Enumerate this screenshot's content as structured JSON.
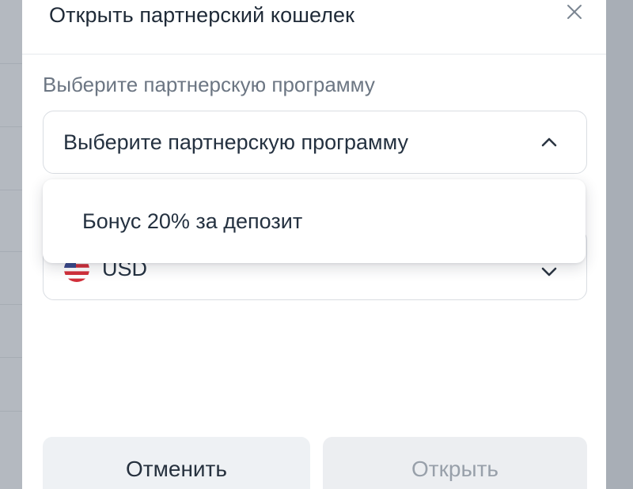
{
  "modal": {
    "title": "Открыть партнерский кошелек",
    "close_icon": "close-icon"
  },
  "program_select": {
    "label": "Выберите партнерскую программу",
    "value": "Выберите партнерскую программу",
    "expanded": true,
    "icon": "chevron-up-icon"
  },
  "program_dropdown": {
    "options": [
      "Бонус 20% за депозит"
    ]
  },
  "currency_select": {
    "value": "USD",
    "flag_icon": "us-flag-icon",
    "icon": "chevron-down-icon"
  },
  "actions": {
    "cancel_label": "Отменить",
    "open_label": "Открыть",
    "open_disabled": true
  },
  "colors": {
    "title_text": "#1f2a37",
    "label_text": "#6c7683",
    "value_text": "#243140",
    "disabled_text": "#98a0aa",
    "backdrop": "#a3aab3"
  }
}
